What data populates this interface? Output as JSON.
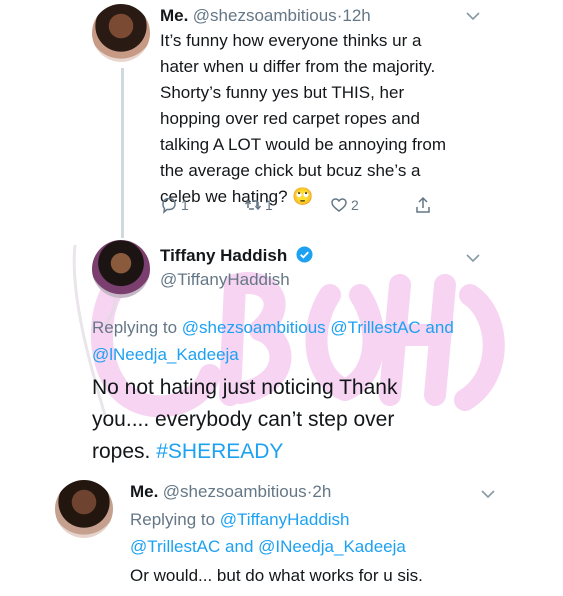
{
  "tweet1": {
    "display_name": "Me.",
    "handle": "@shezsoambitious",
    "separator": "·",
    "time": "12h",
    "lines": [
      "It’s funny how everyone thinks ur a",
      "hater when u differ from the majority.",
      "Shorty’s funny yes but THIS, her",
      "hopping over red carpet ropes and",
      "talking A LOT would be annoying from",
      "the average chick but bcuz she’s a",
      "celeb we hating? 🙄"
    ],
    "reply_count": "1",
    "retweet_count": "1",
    "like_count": "2"
  },
  "tweet2": {
    "display_name": "Tiffany Haddish",
    "handle": "@TiffanyHaddish",
    "replying_prefix": "Replying to",
    "replying_handles_line1": "@shezsoambitious @TrillestAC and",
    "replying_handles_line2": "@lNeedja_Kadeeja",
    "body_line1": "No not hating just noticing Thank",
    "body_line2": "you.... everybody can’t step over",
    "body_line3_text": "ropes.",
    "hashtag": "#SHEREADY"
  },
  "tweet3": {
    "display_name": "Me.",
    "handle": "@shezsoambitious",
    "separator": "·",
    "time": "2h",
    "replying_prefix": "Replying to",
    "replying_line1_handle": "@TiffanyHaddish",
    "replying_line2_handle1": "@TrillestAC",
    "replying_line2_and": "and",
    "replying_line2_handle2": "@INeedja_Kadeeja",
    "body": "Or would... but do what works for u sis."
  },
  "colors": {
    "link": "#1da1f2",
    "muted": "#657786",
    "verified": "#1da1f2",
    "watermark": "#f3c6ee"
  }
}
